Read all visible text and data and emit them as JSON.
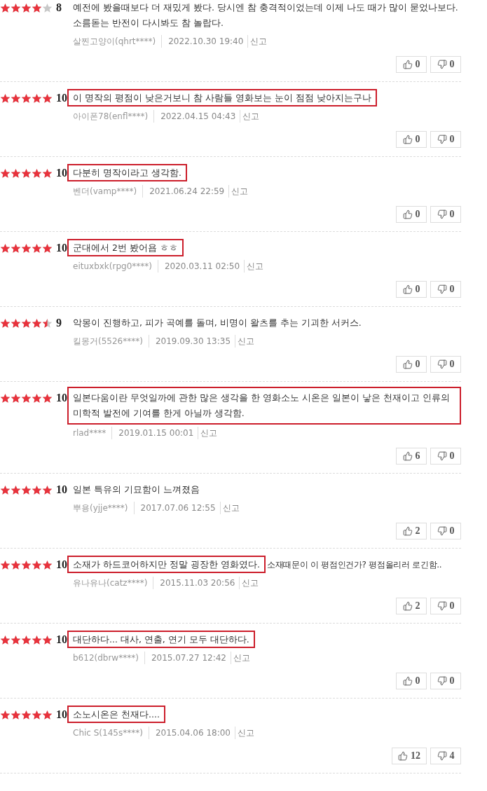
{
  "reviews": [
    {
      "stars": 4,
      "score": "8",
      "segments": [
        {
          "text": "예전에 봤을때보다 더 재밌게 봤다. 당시엔 참 충격적이었는데 이제 나도 때가 많이 묻었나보다. 소름돋는 반전이 다시봐도 참 놀랍다.",
          "highlighted": false
        }
      ],
      "author": "살찐고양이(qhrt****)",
      "date": "2022.10.30 19:40",
      "report": "신고",
      "likes": "0",
      "dislikes": "0"
    },
    {
      "stars": 5,
      "score": "10",
      "segments": [
        {
          "text": "이 명작의 평점이 낮은거보니 참 사람들 영화보는 눈이 점점 낮아지는구나",
          "highlighted": true
        }
      ],
      "author": "아이폰78(enfl****)",
      "date": "2022.04.15 04:43",
      "report": "신고",
      "likes": "0",
      "dislikes": "0"
    },
    {
      "stars": 5,
      "score": "10",
      "segments": [
        {
          "text": "다분히 명작이라고 생각함.",
          "highlighted": true
        }
      ],
      "author": "벤더(vamp****)",
      "date": "2021.06.24 22:59",
      "report": "신고",
      "likes": "0",
      "dislikes": "0"
    },
    {
      "stars": 5,
      "score": "10",
      "segments": [
        {
          "text": "군대에서 2번 봤어욥 ㅎㅎ",
          "highlighted": true
        }
      ],
      "author": "eituxbxk(rpg0****)",
      "date": "2020.03.11 02:50",
      "report": "신고",
      "likes": "0",
      "dislikes": "0"
    },
    {
      "stars": 4.5,
      "score": "9",
      "segments": [
        {
          "text": "악몽이 진행하고, 피가 곡예를 돌며, 비명이 왈츠를 추는 기괴한 서커스.",
          "highlighted": false
        }
      ],
      "author": "킬몽거(5526****)",
      "date": "2019.09.30 13:35",
      "report": "신고",
      "likes": "0",
      "dislikes": "0"
    },
    {
      "stars": 5,
      "score": "10",
      "segments": [
        {
          "text": "일본다움이란 무엇일까에 관한 많은 생각을 한 영화소노 시온은 일본이 낳은 천재이고 인류의 미학적 발전에 기여를 한게 아닐까 생각함.",
          "highlighted": true
        }
      ],
      "author": "rlad****",
      "date": "2019.01.15 00:01",
      "report": "신고",
      "likes": "6",
      "dislikes": "0"
    },
    {
      "stars": 5,
      "score": "10",
      "segments": [
        {
          "text": "일본 특유의 기묘함이 느껴졌음",
          "highlighted": false
        }
      ],
      "author": "뿌용(yjje****)",
      "date": "2017.07.06 12:55",
      "report": "신고",
      "likes": "2",
      "dislikes": "0"
    },
    {
      "stars": 5,
      "score": "10",
      "segments": [
        {
          "text": "소재가 하드코어하지만 정말 굉장한 영화였다.",
          "highlighted": true
        },
        {
          "text": "소재때문이 이 평점인건가? 평점올리러 로긴함..",
          "highlighted": false
        }
      ],
      "author": "유나유나(catz****)",
      "date": "2015.11.03 20:56",
      "report": "신고",
      "likes": "2",
      "dislikes": "0"
    },
    {
      "stars": 5,
      "score": "10",
      "segments": [
        {
          "text": "대단하다... 대사, 연출, 연기 모두 대단하다.",
          "highlighted": true
        }
      ],
      "author": "b612(dbrw****)",
      "date": "2015.07.27 12:42",
      "report": "신고",
      "likes": "0",
      "dislikes": "0"
    },
    {
      "stars": 5,
      "score": "10",
      "segments": [
        {
          "text": "소노시온은 천재다....",
          "highlighted": true
        }
      ],
      "author": "Chic S(145s****)",
      "date": "2015.04.06 18:00",
      "report": "신고",
      "likes": "12",
      "dislikes": "4"
    }
  ]
}
